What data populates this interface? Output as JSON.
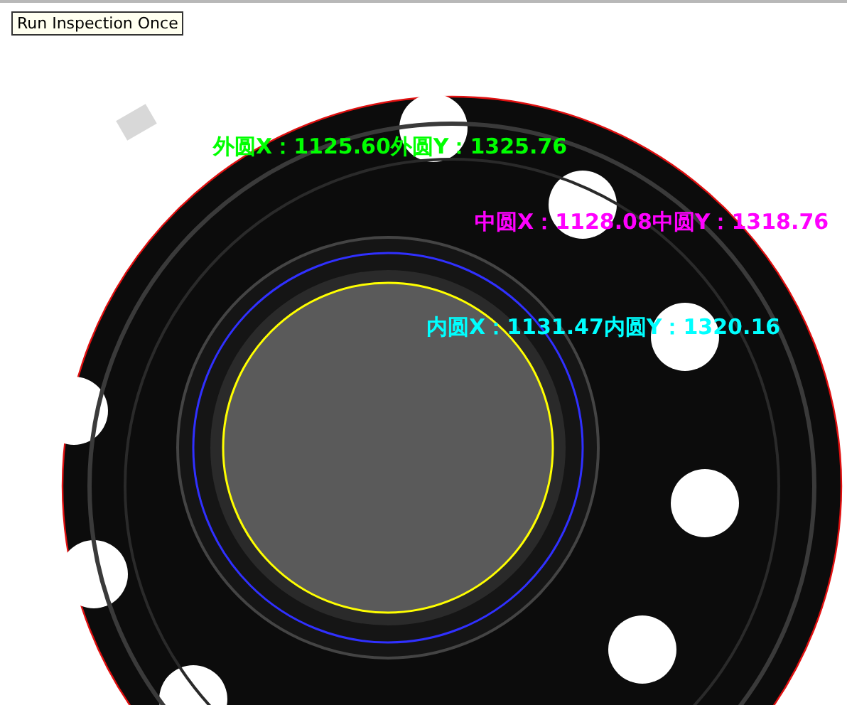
{
  "button": {
    "label": "Run Inspection Once"
  },
  "overlays": [
    {
      "text": "外圆X：1125.60外圆Y：1325.76",
      "color": "#00ff00"
    },
    {
      "text": "中圆X：1128.08中圆Y：1318.76",
      "color": "#ff00ff"
    },
    {
      "text": "内圆X：1131.47内圆Y：1320.16",
      "color": "#00ffff"
    }
  ]
}
